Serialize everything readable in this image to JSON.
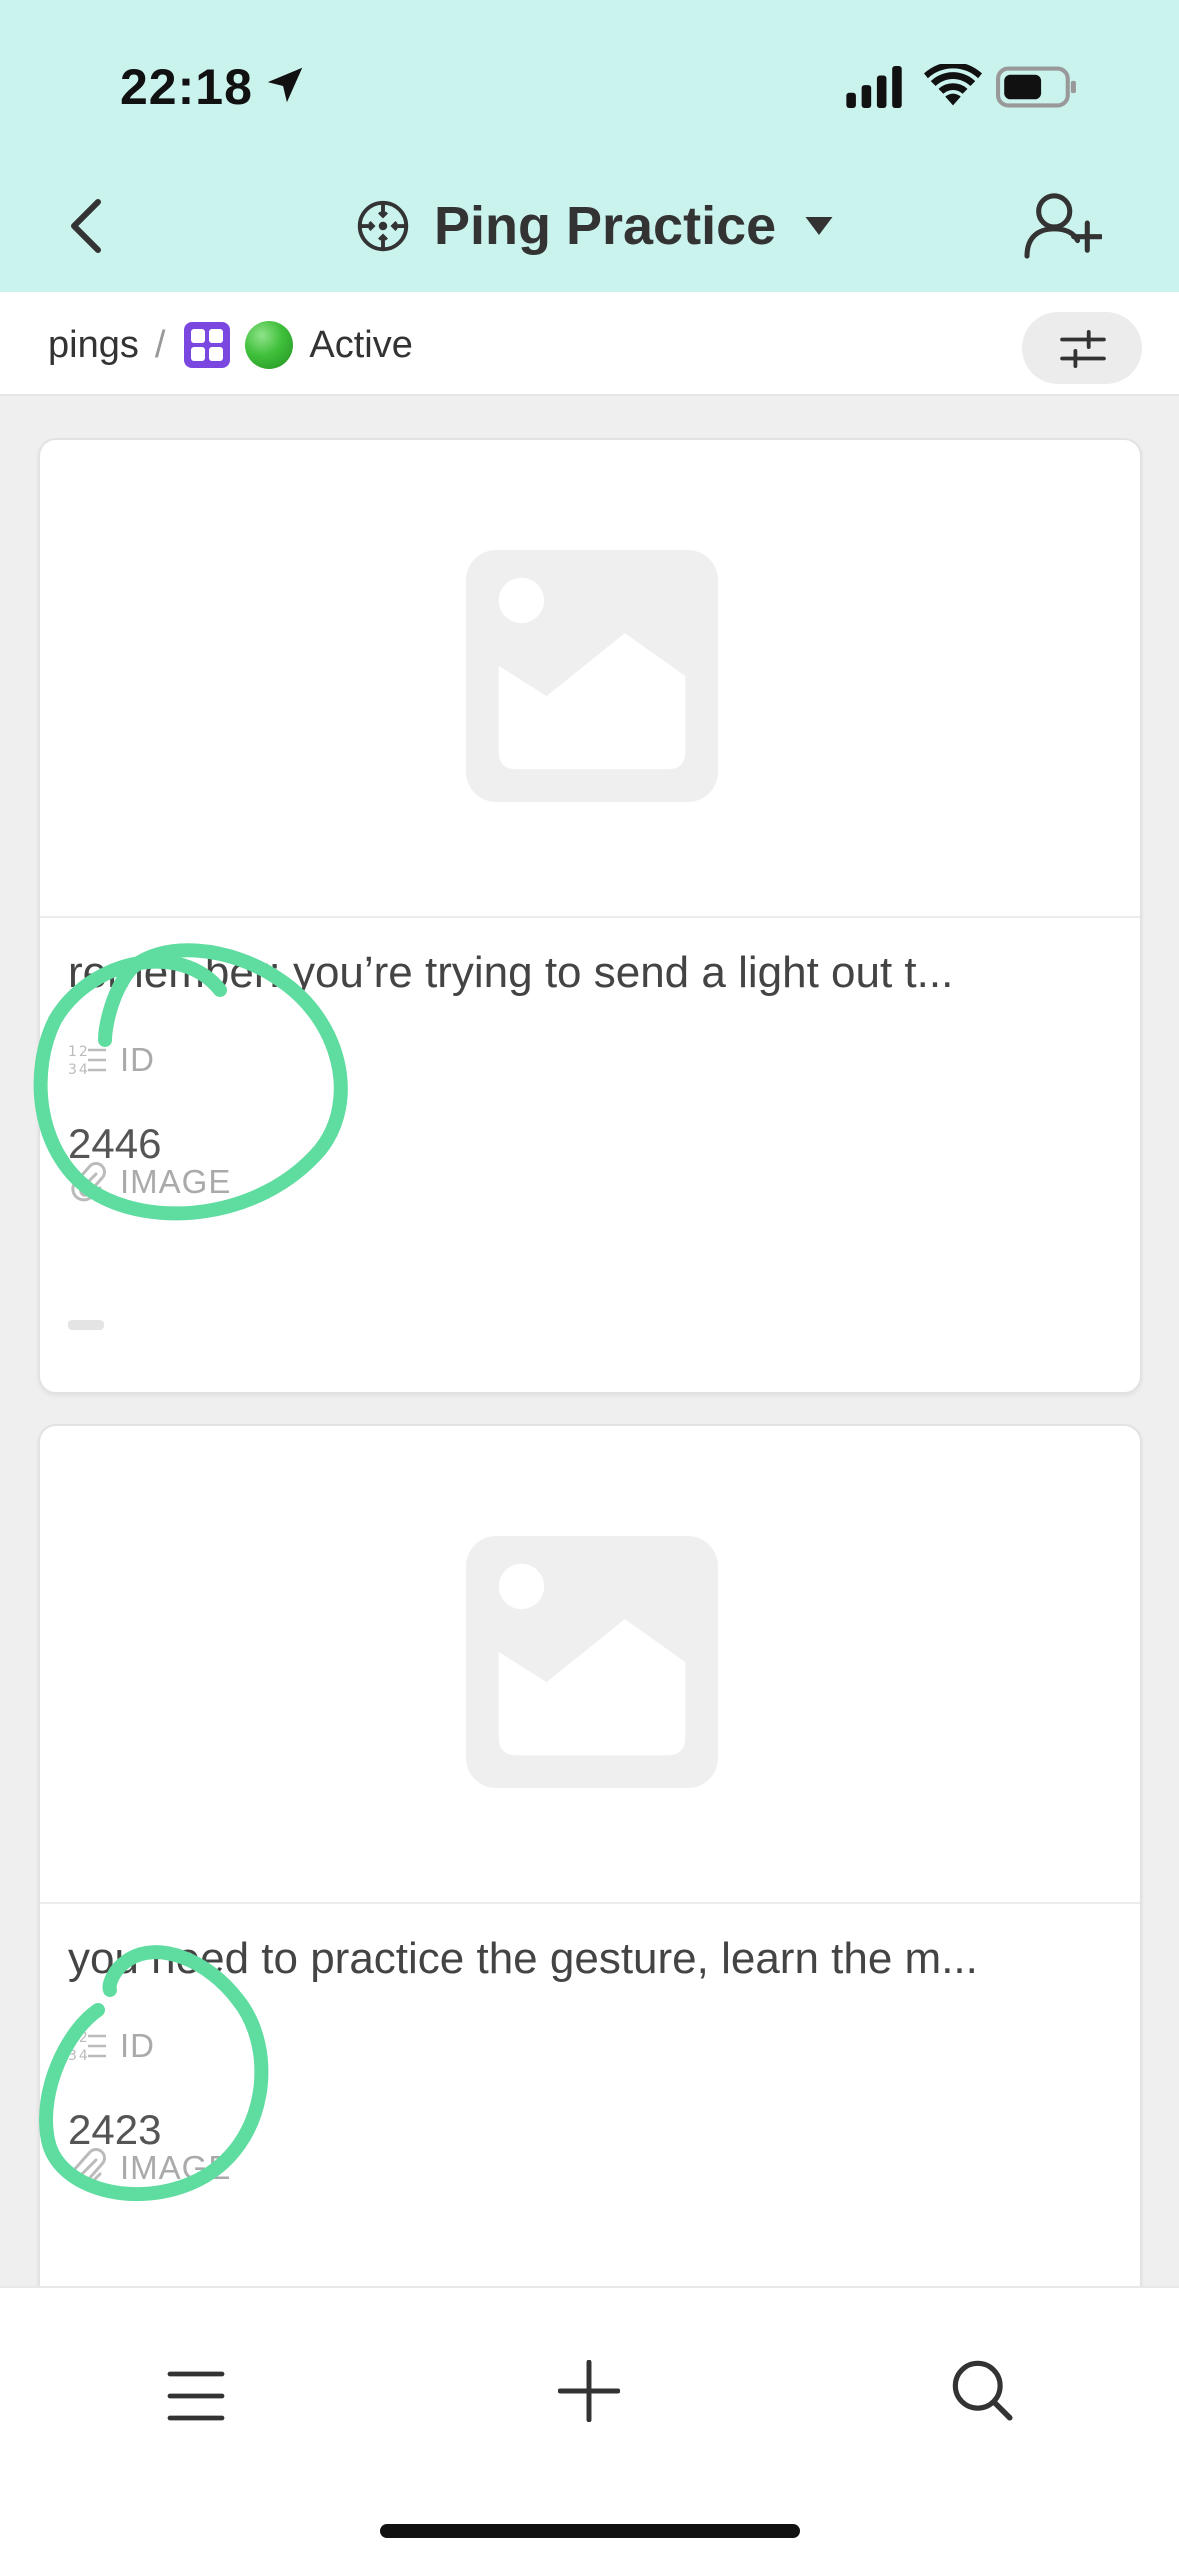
{
  "status_bar": {
    "time": "22:18"
  },
  "header": {
    "title": "Ping Practice",
    "icons": [
      "back-chevron-icon",
      "target-icon",
      "caret-down-icon",
      "add-user-icon"
    ]
  },
  "breadcrumb": {
    "root": "pings",
    "separator": "/",
    "view_label": "Active",
    "view_icon": "grid-icon",
    "status_icon": "green-circle-emoji"
  },
  "cards": [
    {
      "title": "remember: you’re trying to send a light out t...",
      "id_label": "ID",
      "id_value": "2446",
      "image_label": "IMAGE"
    },
    {
      "title": "you need to practice the gesture, learn the m...",
      "id_label": "ID",
      "id_value": "2423",
      "image_label": "IMAGE"
    }
  ],
  "bottom_nav": {
    "icons": [
      "menu-icon",
      "add-icon",
      "search-icon"
    ]
  },
  "colors": {
    "header_bg": "#cbf3ee",
    "annotation": "#5fdc9f",
    "grid_icon": "#7a48e0"
  }
}
